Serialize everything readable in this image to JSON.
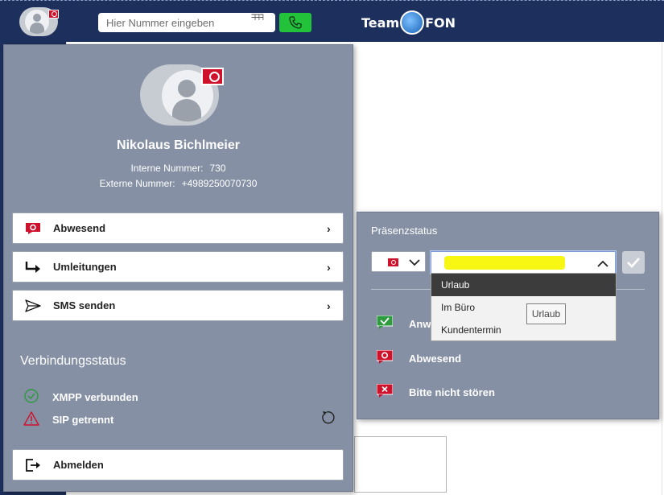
{
  "topbar": {
    "number_placeholder": "Hier Nummer eingeben",
    "keypad_glyph": "ᖷᖷᖷ",
    "logo_left": "Team",
    "logo_right": "FON",
    "bg_color": "#1d2f5c",
    "call_color": "#22c33a"
  },
  "profile": {
    "name": "Nikolaus Bichlmeier",
    "internal_label": "Interne Nummer:",
    "internal_value": "730",
    "external_label": "Externe Nummer:",
    "external_value": "+4989250070730",
    "status_badge_color": "#d0112b"
  },
  "menu": {
    "items": [
      {
        "label": "Abwesend",
        "icon": "away-status-icon"
      },
      {
        "label": "Umleitungen",
        "icon": "redirect-icon"
      },
      {
        "label": "SMS senden",
        "icon": "send-icon"
      }
    ],
    "chevron": "›"
  },
  "connection": {
    "title": "Verbindungsstatus",
    "xmpp": {
      "label": "XMPP verbunden",
      "icon": "check-circle-icon",
      "color": "#2e9b3e"
    },
    "sip": {
      "label": "SIP getrennt",
      "icon": "warning-triangle-icon",
      "color": "#d0112b"
    }
  },
  "logout": {
    "label": "Abmelden",
    "icon": "logout-icon"
  },
  "presence": {
    "title": "Präsenzstatus",
    "options": [
      {
        "label": "Anw",
        "icon": "available-icon",
        "color": "#2e9b3e"
      },
      {
        "label": "Abwesend",
        "icon": "away-icon",
        "color": "#d0112b"
      },
      {
        "label": "Bitte nicht stören",
        "icon": "do-not-disturb-icon",
        "color": "#d0112b"
      }
    ]
  },
  "dropdown": {
    "items": [
      "Urlaub",
      "Im Büro",
      "Kundentermin"
    ],
    "selected": "Urlaub",
    "tooltip": "Urlaub"
  }
}
